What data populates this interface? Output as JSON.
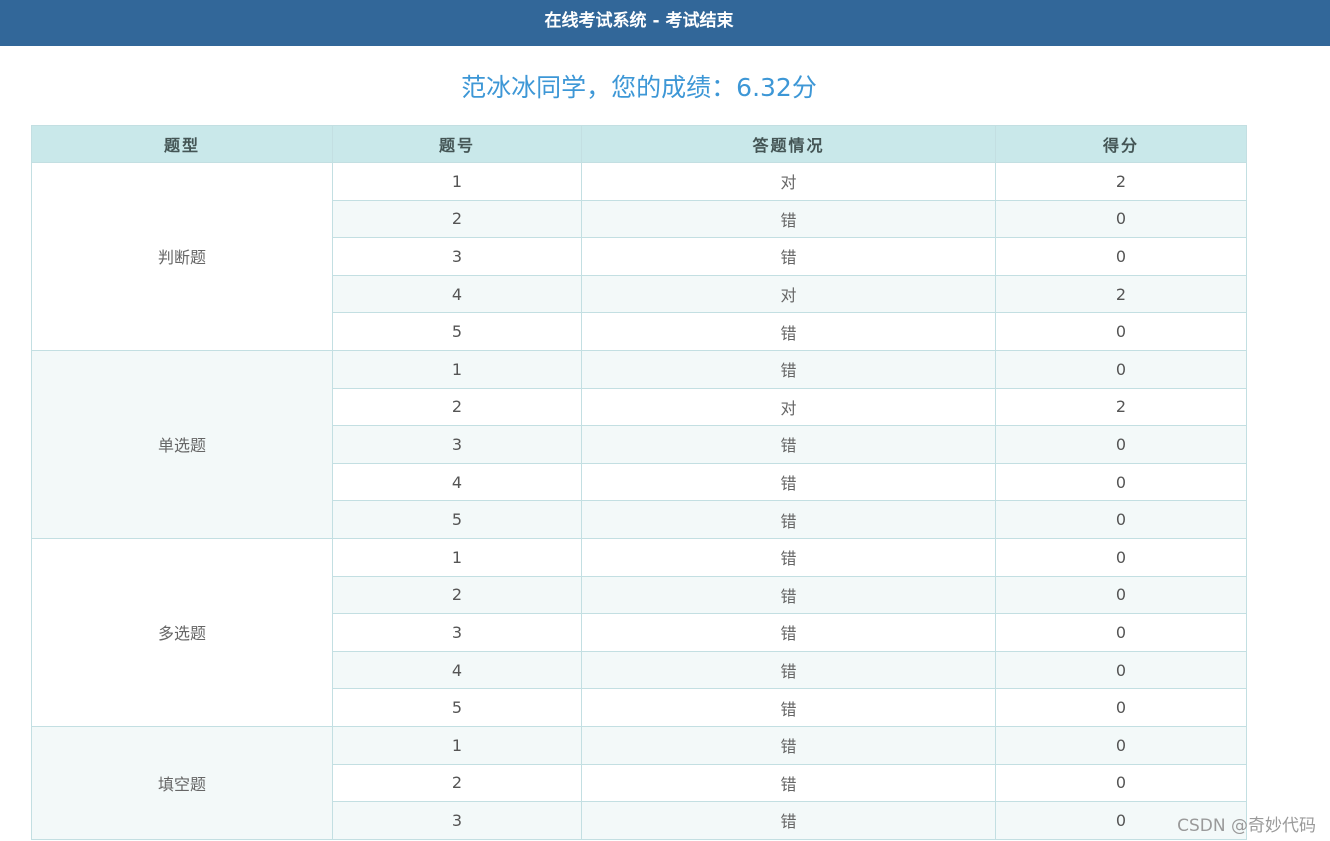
{
  "header": {
    "title": "在线考试系统 - 考试结束"
  },
  "result": {
    "score_text": "范冰冰同学，您的成绩：6.32分"
  },
  "table": {
    "columns": [
      "题型",
      "题号",
      "答题情况",
      "得分"
    ],
    "groups": [
      {
        "type": "判断题",
        "rows": [
          {
            "no": "1",
            "status": "对",
            "score": "2"
          },
          {
            "no": "2",
            "status": "错",
            "score": "0"
          },
          {
            "no": "3",
            "status": "错",
            "score": "0"
          },
          {
            "no": "4",
            "status": "对",
            "score": "2"
          },
          {
            "no": "5",
            "status": "错",
            "score": "0"
          }
        ]
      },
      {
        "type": "单选题",
        "rows": [
          {
            "no": "1",
            "status": "错",
            "score": "0"
          },
          {
            "no": "2",
            "status": "对",
            "score": "2"
          },
          {
            "no": "3",
            "status": "错",
            "score": "0"
          },
          {
            "no": "4",
            "status": "错",
            "score": "0"
          },
          {
            "no": "5",
            "status": "错",
            "score": "0"
          }
        ]
      },
      {
        "type": "多选题",
        "rows": [
          {
            "no": "1",
            "status": "错",
            "score": "0"
          },
          {
            "no": "2",
            "status": "错",
            "score": "0"
          },
          {
            "no": "3",
            "status": "错",
            "score": "0"
          },
          {
            "no": "4",
            "status": "错",
            "score": "0"
          },
          {
            "no": "5",
            "status": "错",
            "score": "0"
          }
        ]
      },
      {
        "type": "填空题",
        "rows": [
          {
            "no": "1",
            "status": "错",
            "score": "0"
          },
          {
            "no": "2",
            "status": "错",
            "score": "0"
          },
          {
            "no": "3",
            "status": "错",
            "score": "0"
          }
        ]
      }
    ]
  },
  "watermark": "CSDN @奇妙代码",
  "colors": {
    "header_bg": "#326799",
    "score_text": "#3d97d6",
    "table_header_bg": "#c9e8ea",
    "row_alt_bg": "#f3f9f9",
    "border": "#c3dfe2"
  }
}
